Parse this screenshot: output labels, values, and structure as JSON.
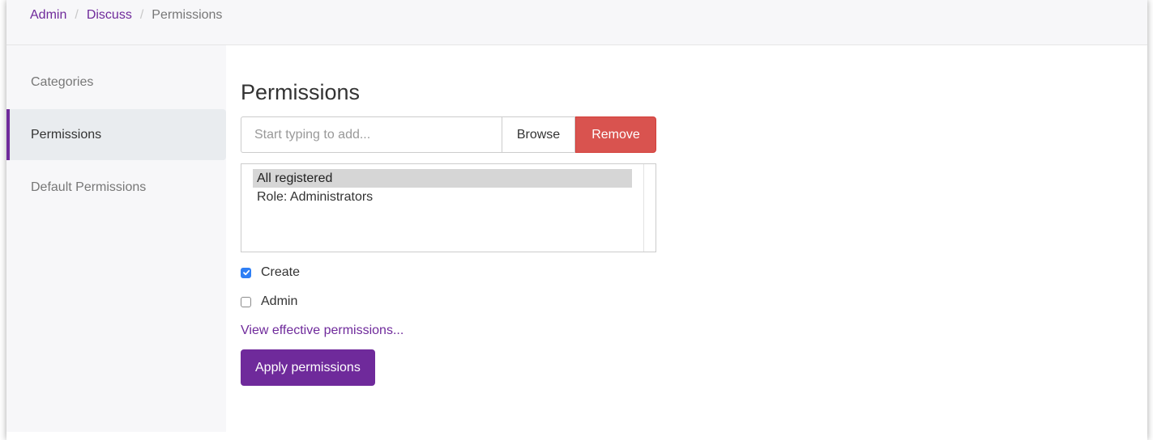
{
  "breadcrumb": {
    "items": [
      "Admin",
      "Discuss"
    ],
    "separator": "/",
    "current": "Permissions"
  },
  "sidebar": {
    "items": [
      {
        "label": "Categories",
        "active": false
      },
      {
        "label": "Permissions",
        "active": true
      },
      {
        "label": "Default Permissions",
        "active": false
      }
    ]
  },
  "main": {
    "title": "Permissions",
    "search": {
      "placeholder": "Start typing to add...",
      "value": ""
    },
    "browse_label": "Browse",
    "remove_label": "Remove",
    "list_options": [
      {
        "label": "All registered",
        "selected": true
      },
      {
        "label": "Role: Administrators",
        "selected": false
      }
    ],
    "checkboxes": [
      {
        "label": "Create",
        "checked": true
      },
      {
        "label": "Admin",
        "checked": false
      }
    ],
    "view_link": "View effective permissions...",
    "apply_label": "Apply permissions"
  },
  "colors": {
    "accent": "#6f2a9b",
    "danger": "#d9534f",
    "checkbox_checked": "#2f7ff5",
    "sidebar_bg": "#f7f7f9"
  }
}
